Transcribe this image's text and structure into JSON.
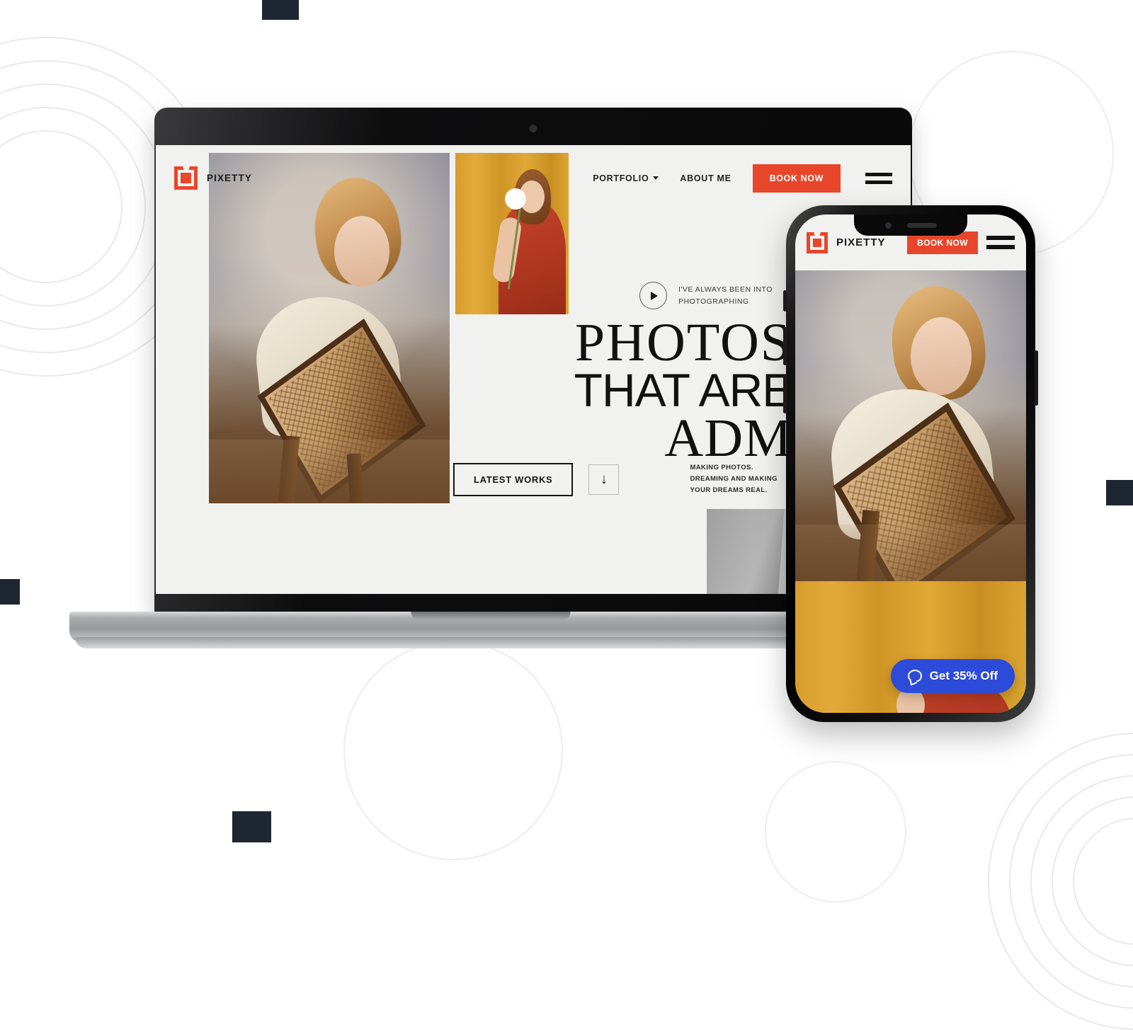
{
  "background": {
    "page_color": "#ffffff",
    "ring_color": "#e9e9e9",
    "square_color": "#1e2631"
  },
  "brand": {
    "name": "PIXETTY",
    "accent_color": "#e8462a",
    "logo_icon": "pixetty-square-logo-icon"
  },
  "desktop": {
    "nav": {
      "portfolio": "PORTFOLIO",
      "about": "ABOUT ME",
      "book_now": "BOOK NOW",
      "menu_icon": "hamburger-menu-icon",
      "caret_icon": "chevron-down-icon"
    },
    "video_promo": {
      "play_icon": "play-icon",
      "line1": "I'VE ALWAYS BEEN INTO",
      "line2": "PHOTOGRAPHING"
    },
    "headline": {
      "line1": "PHOTOS",
      "line2": "THAT ARE",
      "line3": "ADMIRED"
    },
    "cta": {
      "latest_works": "LATEST WORKS",
      "scroll_icon": "arrow-down-icon",
      "scroll_glyph": "↓"
    },
    "tagline": {
      "line1": "MAKING PHOTOS.",
      "line2": "DREAMING AND MAKING",
      "line3": "YOUR DREAMS REAL."
    },
    "photos": [
      {
        "name": "woman-leaning-on-chair-photo"
      },
      {
        "name": "woman-with-flower-yellow-backdrop-photo"
      },
      {
        "name": "grayscale-fabric-photo"
      }
    ]
  },
  "phone": {
    "header": {
      "brand": "PIXETTY",
      "book_now": "BOOK NOW",
      "menu_icon": "hamburger-menu-icon"
    },
    "photos": [
      {
        "name": "woman-leaning-on-chair-photo"
      },
      {
        "name": "yellow-backdrop-photo"
      }
    ],
    "chat_widget": {
      "label": "Get 35% Off",
      "icon": "chat-bubble-icon",
      "color": "#2c4bd8"
    }
  }
}
